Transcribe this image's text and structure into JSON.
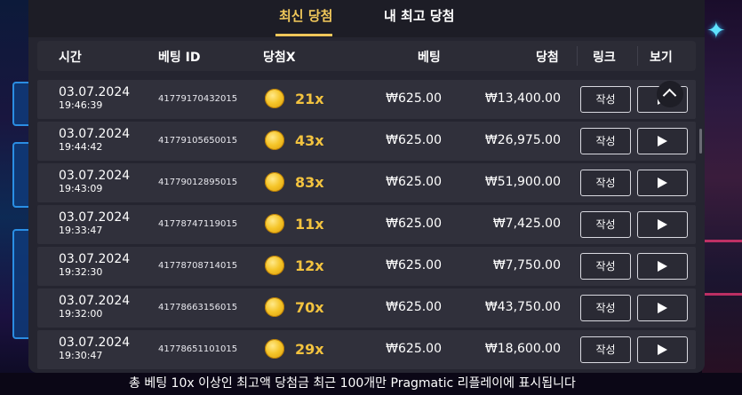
{
  "tabs": [
    {
      "label": "최신 당첨",
      "active": true
    },
    {
      "label": "내 최고 당첨",
      "active": false
    }
  ],
  "columns": {
    "time": "시간",
    "bet_id": "베팅 ID",
    "multiplier": "당첨X",
    "bet": "베팅",
    "win": "당첨",
    "link": "링크",
    "view": "보기"
  },
  "rows": [
    {
      "date": "03.07.2024",
      "time": "19:46:39",
      "bet_id": "41779170432015",
      "multiplier": "21x",
      "bet": "₩625.00",
      "win": "₩13,400.00",
      "link_label": "작성"
    },
    {
      "date": "03.07.2024",
      "time": "19:44:42",
      "bet_id": "41779105650015",
      "multiplier": "43x",
      "bet": "₩625.00",
      "win": "₩26,975.00",
      "link_label": "작성"
    },
    {
      "date": "03.07.2024",
      "time": "19:43:09",
      "bet_id": "41779012895015",
      "multiplier": "83x",
      "bet": "₩625.00",
      "win": "₩51,900.00",
      "link_label": "작성"
    },
    {
      "date": "03.07.2024",
      "time": "19:33:47",
      "bet_id": "41778747119015",
      "multiplier": "11x",
      "bet": "₩625.00",
      "win": "₩7,425.00",
      "link_label": "작성"
    },
    {
      "date": "03.07.2024",
      "time": "19:32:30",
      "bet_id": "41778708714015",
      "multiplier": "12x",
      "bet": "₩625.00",
      "win": "₩7,750.00",
      "link_label": "작성"
    },
    {
      "date": "03.07.2024",
      "time": "19:32:00",
      "bet_id": "41778663156015",
      "multiplier": "70x",
      "bet": "₩625.00",
      "win": "₩43,750.00",
      "link_label": "작성"
    },
    {
      "date": "03.07.2024",
      "time": "19:30:47",
      "bet_id": "41778651101015",
      "multiplier": "29x",
      "bet": "₩625.00",
      "win": "₩18,600.00",
      "link_label": "작성"
    }
  ],
  "footer_note": "총 베팅 10x 이상인 최고액 당첨금 최근 100개만 Pragmatic 리플레이에 표시됩니다",
  "colors": {
    "accent": "#f0c75a",
    "multiplier": "#f3c33f",
    "panel": "#252530",
    "row": "#30303b"
  }
}
